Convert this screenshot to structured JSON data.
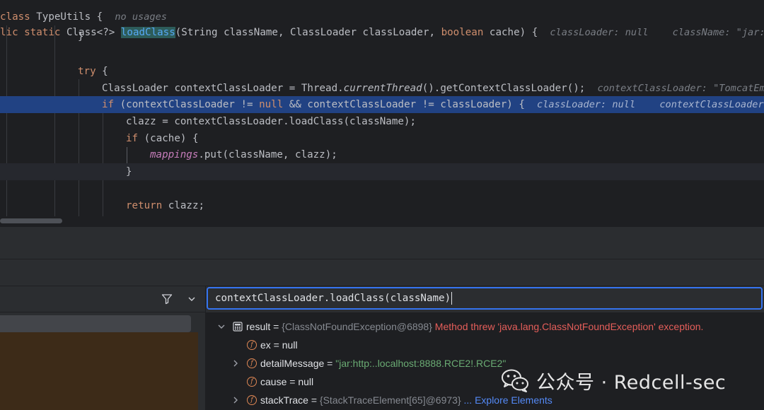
{
  "editor": {
    "line0": {
      "kw": "class",
      "name": " TypeUtils {",
      "hint": "no usages"
    },
    "line1": {
      "kw1": "lic",
      "kw2": "static",
      "type": "Class<?>",
      "method": "loadClass",
      "p1": "(String className, ClassLoader classLoader, ",
      "kw3": "boolean",
      "p2": " cache) {",
      "hint1": "classLoader: null",
      "hint2": "className: \"jar:"
    },
    "line2": "}",
    "line3_kw": "try",
    "line3_rest": " {",
    "line4": {
      "a": "ClassLoader contextClassLoader = Thread.",
      "b": "currentThread",
      "c": "().getContextClassLoader();",
      "hint": "contextClassLoader: \"TomcatEm"
    },
    "line5": {
      "kw": "if",
      "a": " (contextClassLoader != ",
      "kw2": "null",
      "b": " && contextClassLoader != classLoader) {",
      "hint1": "classLoader: null",
      "hint2": "contextClassLoader"
    },
    "line6": "clazz = contextClassLoader.loadClass(className);",
    "line7": {
      "kw": "if",
      "rest": " (cache) {"
    },
    "line8": {
      "field": "mappings",
      "rest": ".put(className, clazz);"
    },
    "line9": "}",
    "line10": {
      "kw": "return",
      "rest": " clazz;"
    }
  },
  "debugger": {
    "expression": "contextClassLoader.loadClass(className)",
    "icons": {
      "filter": "filter-icon",
      "dropdown": "chevron-down-icon",
      "result": "calculator-icon",
      "field": "field-f-icon"
    },
    "variables": [
      {
        "arrow": "expanded",
        "name": "result",
        "eq": " = ",
        "type": "{ClassNotFoundException@6898}",
        "extra": " Method threw 'java.lang.ClassNotFoundException' exception."
      },
      {
        "arrow": "none",
        "name": "ex",
        "eq": " = ",
        "value": "null"
      },
      {
        "arrow": "collapsed",
        "name": "detailMessage",
        "eq": " = ",
        "value": "\"jar:http:..localhost:8888.RCE2!.RCE2\""
      },
      {
        "arrow": "none",
        "name": "cause",
        "eq": " = ",
        "value": "null"
      },
      {
        "arrow": "collapsed",
        "name": "stackTrace",
        "eq": " = ",
        "type": "{StackTraceElement[65]@6973}",
        "link": " ... Explore Elements"
      }
    ]
  },
  "watermark": {
    "text": "公众号 · Redcell-sec",
    "icon": "wechat-icon"
  },
  "colors": {
    "highlight": "#214283",
    "keyword": "#cf8e6d",
    "method": "#56a8f5",
    "error": "#e55e5a",
    "string": "#6aab73",
    "link": "#548af7",
    "focus": "#3574f0"
  }
}
